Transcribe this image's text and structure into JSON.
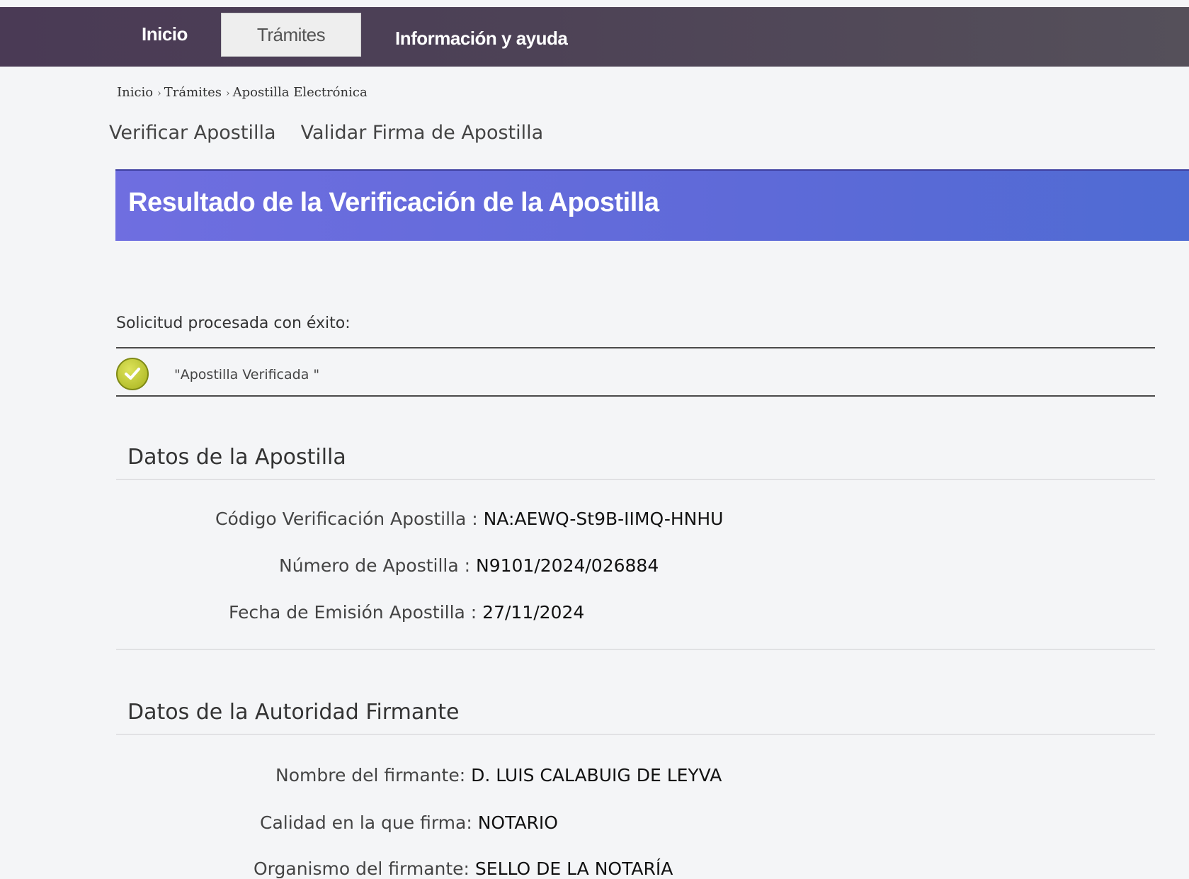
{
  "nav": {
    "inicio": "Inicio",
    "tramites": "Trámites",
    "info": "Información y ayuda"
  },
  "breadcrumb": {
    "items": [
      "Inicio",
      "Trámites",
      "Apostilla Electrónica"
    ],
    "separator": "›"
  },
  "subtabs": [
    "Verificar Apostilla",
    "Validar Firma de Apostilla"
  ],
  "result": {
    "title": "Resultado de la Verificación de la Apostilla",
    "success_label": "Solicitud procesada con éxito:",
    "status_text": "\"Apostilla Verificada \"",
    "status_icon": "check-circle-icon",
    "accent_color": "#6b6de0"
  },
  "apostilla": {
    "section_title": "Datos de la Apostilla",
    "fields": [
      {
        "label": "Código Verificación Apostilla : ",
        "value": "NA:AEWQ-St9B-IIMQ-HNHU"
      },
      {
        "label": "Número de Apostilla : ",
        "value": "N9101/2024/026884"
      },
      {
        "label": "Fecha de Emisión Apostilla : ",
        "value": "27/11/2024"
      }
    ]
  },
  "autoridad": {
    "section_title": "Datos de la Autoridad Firmante",
    "fields": [
      {
        "label": "Nombre del firmante: ",
        "value": "D. LUIS CALABUIG DE LEYVA"
      },
      {
        "label": "Calidad en la que firma: ",
        "value": "NOTARIO"
      },
      {
        "label": "Organismo del firmante: ",
        "value": "SELLO DE LA NOTARÍA"
      }
    ]
  }
}
